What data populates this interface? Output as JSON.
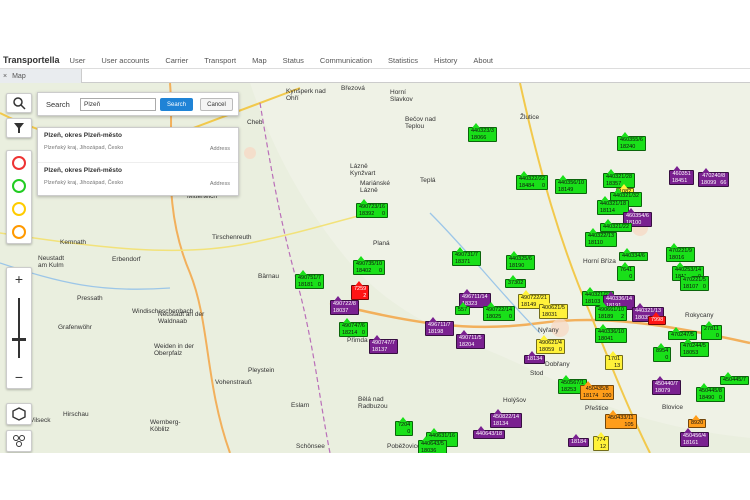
{
  "brand": "Transportella",
  "menu": [
    "User",
    "User accounts",
    "Carrier",
    "Transport",
    "Map",
    "Status",
    "Communication",
    "Statistics",
    "History",
    "About"
  ],
  "tab": {
    "close_icon": "×",
    "label": "Map"
  },
  "search": {
    "label": "Search",
    "value": "Plzeň",
    "search_label": "Search",
    "cancel_label": "Cancel"
  },
  "results": [
    {
      "title": "Plzeň,  okres Plzeň-město",
      "sub": "Plzeňský kraj, Jihozápad, Česko",
      "type": "Address"
    },
    {
      "title": "Plzeň,  okres Plzeň-město",
      "sub": "Plzeňský kraj, Jihozápad, Česko",
      "type": "Address"
    }
  ],
  "zoom": {
    "plus": "+",
    "minus": "−"
  },
  "places": [
    "Kynšperk nad Ohří",
    "Březová",
    "Horní Slavkov",
    "Bečov nad Teplou",
    "Žlutice",
    "Cheb",
    "Lázně Kynžvart",
    "Mariánské Lázně",
    "Teplá",
    "Mitterteich",
    "Tirschenreuth",
    "Planá",
    "Kemnath",
    "Erbendorf",
    "Neustadt am Kulm",
    "Bärnau",
    "Pressath",
    "Windischeschenbach",
    "Grafenwöhr",
    "Neustadt an der Waldnaab",
    "Weiden in der Oberpfalz",
    "Vohenstrauß",
    "Pleystein",
    "Přimda",
    "Bělá nad Radbuzou",
    "Nyřany",
    "Stod",
    "Dobřany",
    "Holýšov",
    "Rokycany",
    "Blovice",
    "Přeštice",
    "Hirschau",
    "Eslarn",
    "Schönsee",
    "Vilseck",
    "Wernberg-Köblitz",
    "Poběžovice",
    "Horní Bříza"
  ],
  "markers": [
    {
      "a": "440323/3",
      "b1": "18066",
      "b2": "",
      "color": "green"
    },
    {
      "a": "460355/6",
      "b1": "18240",
      "b2": "",
      "color": "green"
    },
    {
      "a": "440321/28",
      "b1": "18357",
      "b2": "",
      "color": "green"
    },
    {
      "a": "440322/22",
      "b1": "18484",
      "b2": "0",
      "color": "green"
    },
    {
      "a": "440356/10",
      "b1": "18149",
      "b2": "",
      "color": "green"
    },
    {
      "a": "460351",
      "b1": "18451",
      "b2": "",
      "color": "purple"
    },
    {
      "a": "470240/8",
      "b1": "18099",
      "b2": "66",
      "color": "purple"
    },
    {
      "a": "1082",
      "b1": "",
      "b2": "",
      "color": "yellow"
    },
    {
      "a": "440321/32",
      "b1": "18093",
      "b2": "",
      "color": "green"
    },
    {
      "a": "440321/18",
      "b1": "18114",
      "b2": "",
      "color": "green"
    },
    {
      "a": "460354/6",
      "b1": "18100",
      "b2": "",
      "color": "purple"
    },
    {
      "a": "440321/22",
      "b1": "",
      "b2": "",
      "color": "green"
    },
    {
      "a": "440322/13",
      "b1": "18110",
      "b2": "",
      "color": "green"
    },
    {
      "a": "490723/16",
      "b1": "18392",
      "b2": "0",
      "color": "green"
    },
    {
      "a": "470221/9",
      "b1": "18016",
      "b2": "",
      "color": "green"
    },
    {
      "a": "440334/6",
      "b1": "",
      "b2": "",
      "color": "green"
    },
    {
      "a": "440325/6",
      "b1": "18190",
      "b2": "",
      "color": "green"
    },
    {
      "a": "490731/7",
      "b1": "18371",
      "b2": "",
      "color": "green"
    },
    {
      "a": "490735/10",
      "b1": "18402",
      "b2": "0",
      "color": "green"
    },
    {
      "a": "440253/14",
      "b1": "18117",
      "b2": "0",
      "color": "green"
    },
    {
      "a": "470221/5",
      "b1": "18107",
      "b2": "0",
      "color": "green"
    },
    {
      "a": "7641",
      "b1": "",
      "b2": "0",
      "color": "green"
    },
    {
      "a": "490751/7",
      "b1": "18181",
      "b2": "0",
      "color": "green"
    },
    {
      "a": "7259",
      "b1": "",
      "b2": "2",
      "color": "red"
    },
    {
      "a": "490722/8",
      "b1": "18037",
      "b2": "",
      "color": "purple"
    },
    {
      "a": "37302",
      "b1": "",
      "b2": "",
      "color": "green"
    },
    {
      "a": "490722/21",
      "b1": "18149",
      "b2": "",
      "color": "yellow"
    },
    {
      "a": "496711/14",
      "b1": "18323",
      "b2": "",
      "color": "purple"
    },
    {
      "a": "440321/27",
      "b1": "18103",
      "b2": "",
      "color": "green"
    },
    {
      "a": "440336/14",
      "b1": "18191",
      "b2": "",
      "color": "purple"
    },
    {
      "a": "490722/14",
      "b1": "18025",
      "b2": "0",
      "color": "green"
    },
    {
      "a": "557",
      "b1": "",
      "b2": "",
      "color": "green"
    },
    {
      "a": "400621/5",
      "b1": "18031",
      "b2": "",
      "color": "yellow"
    },
    {
      "a": "490661/10",
      "b1": "18189",
      "b2": "2",
      "color": "green"
    },
    {
      "a": "440321/13",
      "b1": "18035",
      "b2": "",
      "color": "purple"
    },
    {
      "a": "7998",
      "b1": "",
      "b2": "",
      "color": "red"
    },
    {
      "a": "470247/5",
      "b1": "",
      "b2": "",
      "color": "green"
    },
    {
      "a": "27811",
      "b1": "",
      "b2": "0",
      "color": "green"
    },
    {
      "a": "490747/6",
      "b1": "18214",
      "b2": "0",
      "color": "green"
    },
    {
      "a": "496711/7",
      "b1": "18198",
      "b2": "",
      "color": "purple"
    },
    {
      "a": "490711/5",
      "b1": "18204",
      "b2": "",
      "color": "purple"
    },
    {
      "a": "490747/7",
      "b1": "18137",
      "b2": "",
      "color": "purple"
    },
    {
      "a": "440336/10",
      "b1": "18041",
      "b2": "",
      "color": "green"
    },
    {
      "a": "490621/4",
      "b1": "18059",
      "b2": "0",
      "color": "yellow"
    },
    {
      "a": "8954",
      "b1": "",
      "b2": "0",
      "color": "green"
    },
    {
      "a": "470244/5",
      "b1": "18053",
      "b2": "",
      "color": "green"
    },
    {
      "a": "18134",
      "b1": "",
      "b2": "",
      "color": "purple"
    },
    {
      "a": "1701",
      "b1": "",
      "b2": "13",
      "color": "yellow"
    },
    {
      "a": "450567/1",
      "b1": "18253",
      "b2": "0",
      "color": "green"
    },
    {
      "a": "450435/8",
      "b1": "18174",
      "b2": "100",
      "color": "orange"
    },
    {
      "a": "450440/7",
      "b1": "18079",
      "b2": "",
      "color": "purple"
    },
    {
      "a": "450445/8",
      "b1": "18490",
      "b2": "0",
      "color": "green"
    },
    {
      "a": "450445/7",
      "b1": "",
      "b2": "",
      "color": "green"
    },
    {
      "a": "450822/14",
      "b1": "18134",
      "b2": "",
      "color": "purple"
    },
    {
      "a": "7204",
      "b1": "",
      "b2": "0",
      "color": "green"
    },
    {
      "a": "440631/16",
      "b1": "18420",
      "b2": "",
      "color": "green"
    },
    {
      "a": "440643/5",
      "b1": "18036",
      "b2": "",
      "color": "green"
    },
    {
      "a": "440643/18",
      "b1": "",
      "b2": "",
      "color": "purple"
    },
    {
      "a": "450433/11",
      "b1": "",
      "b2": "105",
      "color": "orange"
    },
    {
      "a": "18184",
      "b1": "",
      "b2": "",
      "color": "purple"
    },
    {
      "a": "774",
      "b1": "",
      "b2": "12",
      "color": "yellow"
    },
    {
      "a": "8920",
      "b1": "",
      "b2": "",
      "color": "orange"
    },
    {
      "a": "450456/4",
      "b1": "18161",
      "b2": "",
      "color": "purple"
    }
  ]
}
